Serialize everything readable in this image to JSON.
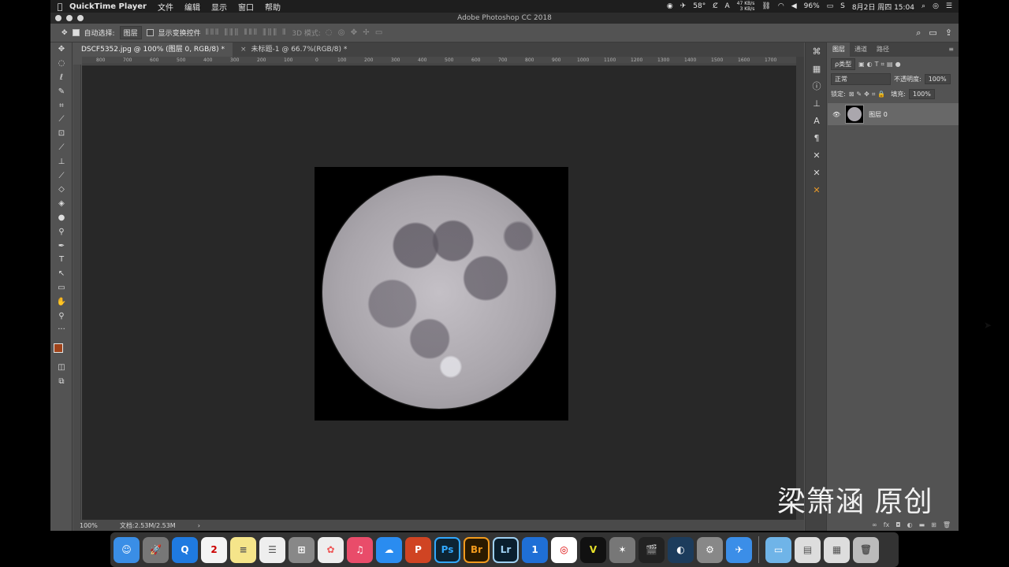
{
  "menubar": {
    "app_name": "QuickTime Player",
    "menus": [
      "文件",
      "编辑",
      "显示",
      "窗口",
      "帮助"
    ],
    "temperature": "58°",
    "net_up": "47 KB/s",
    "net_down": "3 KB/s",
    "battery": "96%",
    "datetime": "8月2日 周四  15:04"
  },
  "window": {
    "title": "Adobe Photoshop CC 2018"
  },
  "options": {
    "auto_select_label": "自动选择:",
    "auto_select_target": "图层",
    "show_transform_label": "显示变换控件",
    "mode_3d": "3D 模式:"
  },
  "tabs": [
    {
      "label": "DSCF5352.jpg @ 100% (图层 0, RGB/8) *"
    },
    {
      "label": "未标题-1 @ 66.7%(RGB/8) *"
    }
  ],
  "ruler": {
    "ticks": [
      "800",
      "700",
      "600",
      "500",
      "400",
      "300",
      "200",
      "100",
      "0",
      "100",
      "200",
      "300",
      "400",
      "500",
      "600",
      "700",
      "800",
      "900",
      "1000",
      "1100",
      "1200",
      "1300",
      "1400",
      "1500",
      "1600",
      "1700"
    ]
  },
  "status": {
    "zoom": "100%",
    "doc_size": "文档:2.53M/2.53M",
    "arrow": "›"
  },
  "layers_panel": {
    "tabs": [
      "图层",
      "通道",
      "路径"
    ],
    "filter_label": "ρ类型",
    "blend_mode": "正常",
    "opacity_label": "不透明度:",
    "opacity_value": "100%",
    "lock_label": "锁定:",
    "fill_label": "填充:",
    "fill_value": "100%",
    "layers": [
      {
        "name": "图层 0",
        "visible": true
      }
    ]
  },
  "watermark": "梁箫涵 原创",
  "colors": {
    "foreground": "#a0431a",
    "background": "#ffffff"
  }
}
